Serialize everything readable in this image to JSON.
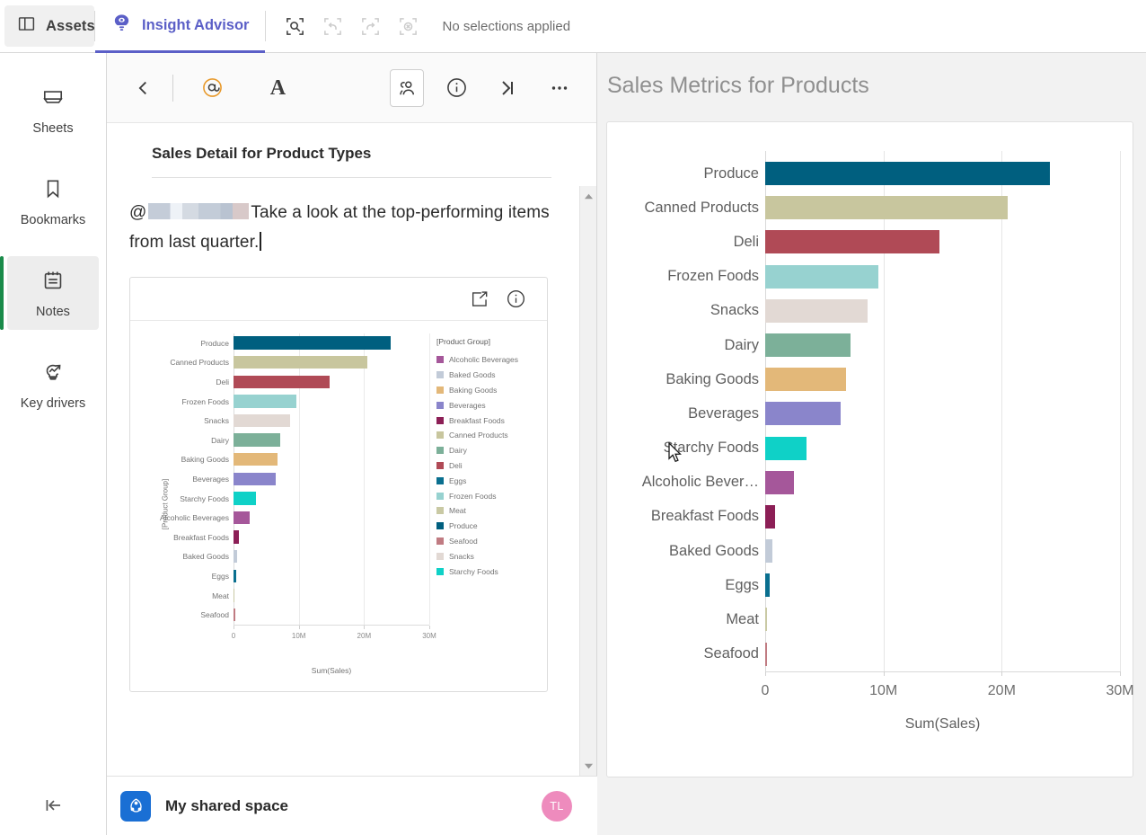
{
  "topbar": {
    "assets_label": "Assets",
    "assets_icon": "panel-left-icon",
    "insight_advisor_label": "Insight Advisor",
    "insight_advisor_icon": "lightbulb-eye-icon",
    "tools": [
      {
        "name": "selection-search-icon",
        "label": "Selection search",
        "disabled": false
      },
      {
        "name": "undo-icon",
        "label": "Step back",
        "disabled": true
      },
      {
        "name": "redo-icon",
        "label": "Step forward",
        "disabled": true
      },
      {
        "name": "clear-selections-icon",
        "label": "Clear all selections",
        "disabled": true
      }
    ],
    "selection_status": "No selections applied"
  },
  "rail": {
    "items": [
      {
        "label": "Sheets",
        "icon": "sheets-icon",
        "active": false
      },
      {
        "label": "Bookmarks",
        "icon": "bookmark-icon",
        "active": false
      },
      {
        "label": "Notes",
        "icon": "notes-icon",
        "active": true
      },
      {
        "label": "Key drivers",
        "icon": "key-drivers-icon",
        "active": false
      }
    ],
    "collapse_icon": "collapse-left-icon",
    "accent_color": "#1a8b4a"
  },
  "notes": {
    "toolbar": [
      {
        "name": "back-icon",
        "label": "Back",
        "boxed": false
      },
      {
        "name": "mention-at-icon",
        "label": "Mention",
        "boxed": false
      },
      {
        "name": "text-format-icon",
        "label": "Text format",
        "boxed": false
      },
      {
        "name": "collaborators-icon",
        "label": "Collaborators",
        "boxed": true
      },
      {
        "name": "info-icon",
        "label": "Note information",
        "boxed": false
      },
      {
        "name": "collapse-right-icon",
        "label": "Collapse panel",
        "boxed": false
      },
      {
        "name": "more-options-icon",
        "label": "More options",
        "boxed": false
      }
    ],
    "title": "Sales Detail for Product Types",
    "body_prefix": "@",
    "body_text": "Take a look at the top-performing items from last quarter.",
    "footer": {
      "space_name": "My shared space",
      "space_icon": "shared-space-icon",
      "avatar_initials": "TL",
      "avatar_color": "#ee8bbd"
    }
  },
  "embedded_chart": {
    "share_icon": "share-export-icon",
    "info_icon": "info-icon"
  },
  "main": {
    "title": "Sales Metrics for Products"
  },
  "chart_data": {
    "type": "bar",
    "orientation": "horizontal",
    "title": "Sales Metrics for Products",
    "xlabel": "Sum(Sales)",
    "ylabel": "[Product Group]",
    "xlim": [
      0,
      30000000
    ],
    "xticks": [
      0,
      10000000,
      20000000,
      30000000
    ],
    "xtick_labels": [
      "0",
      "10M",
      "20M",
      "30M"
    ],
    "grid": true,
    "legend_title": "[Product Group]",
    "legend_position": "right",
    "categories": [
      "Produce",
      "Canned Products",
      "Deli",
      "Frozen Foods",
      "Snacks",
      "Dairy",
      "Baking Goods",
      "Beverages",
      "Starchy Foods",
      "Alcoholic Beverages",
      "Breakfast Foods",
      "Baked Goods",
      "Eggs",
      "Meat",
      "Seafood"
    ],
    "truncated_labels": {
      "Alcoholic Beverages": "Alcoholic Bever…"
    },
    "values": [
      24100000,
      20500000,
      14700000,
      9600000,
      8650000,
      7200000,
      6800000,
      6400000,
      3500000,
      2450000,
      800000,
      600000,
      400000,
      130000,
      60000
    ],
    "colors": [
      "#005f7f",
      "#c8c69e",
      "#b04a56",
      "#97d2d0",
      "#e2d9d4",
      "#7cb099",
      "#e3b879",
      "#8a85cb",
      "#0fd1c7",
      "#a5579a",
      "#8c1f56",
      "#c2cbd8",
      "#0a6f8f",
      "#c9c9a4",
      "#c07b82"
    ],
    "legend_entries": [
      {
        "label": "Alcoholic Beverages",
        "color": "#a5579a"
      },
      {
        "label": "Baked Goods",
        "color": "#c2cbd8"
      },
      {
        "label": "Baking Goods",
        "color": "#e3b879"
      },
      {
        "label": "Beverages",
        "color": "#8a85cb"
      },
      {
        "label": "Breakfast Foods",
        "color": "#8c1f56"
      },
      {
        "label": "Canned Products",
        "color": "#c8c69e"
      },
      {
        "label": "Dairy",
        "color": "#7cb099"
      },
      {
        "label": "Deli",
        "color": "#b04a56"
      },
      {
        "label": "Eggs",
        "color": "#0a6f8f"
      },
      {
        "label": "Frozen Foods",
        "color": "#97d2d0"
      },
      {
        "label": "Meat",
        "color": "#c9c9a4"
      },
      {
        "label": "Produce",
        "color": "#005f7f"
      },
      {
        "label": "Seafood",
        "color": "#c07b82"
      },
      {
        "label": "Snacks",
        "color": "#e2d9d4"
      },
      {
        "label": "Starchy Foods",
        "color": "#0fd1c7"
      }
    ]
  }
}
